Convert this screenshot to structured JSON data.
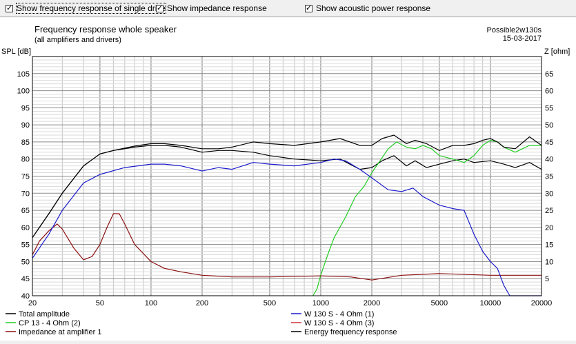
{
  "checkboxes": [
    {
      "label": "Show frequency response of single drive",
      "checked": true
    },
    {
      "label": "Show impedance response",
      "checked": true
    },
    {
      "label": "Show acoustic power response",
      "checked": true
    }
  ],
  "chart_data": {
    "type": "line",
    "title": "Frequency response whole speaker",
    "subtitle": "(all amplifiers and drivers)",
    "top_right": [
      "Possible2w130s",
      "15-03-2017"
    ],
    "ylabel_left": "SPL [dB]",
    "ylabel_right": "Z [ohm]",
    "x_scale": "log",
    "xlim": [
      20,
      20000
    ],
    "ylim_left": [
      40,
      110
    ],
    "ylim_right": [
      0,
      70
    ],
    "x_ticks": [
      20,
      50,
      100,
      200,
      500,
      1000,
      2000,
      5000,
      10000,
      20000
    ],
    "x_tick_labels": [
      "20",
      "50",
      "100",
      "200",
      "500",
      "1000",
      "2000",
      "5000",
      "10000",
      "20000"
    ],
    "y_ticks_left": [
      "40",
      "45",
      "50",
      "55",
      "60",
      "65",
      "70",
      "75",
      "80",
      "85",
      "90",
      "95",
      "100",
      "105"
    ],
    "y_ticks_right": [
      "5",
      "10",
      "15",
      "20",
      "25",
      "30",
      "35",
      "40",
      "45",
      "50",
      "55",
      "60",
      "65"
    ],
    "grid": true,
    "series": [
      {
        "name": "Total amplitude",
        "axis": "left",
        "color": "#000000",
        "x": [
          20,
          25,
          30,
          40,
          50,
          60,
          70,
          80,
          100,
          120,
          150,
          200,
          250,
          300,
          400,
          500,
          700,
          1000,
          1300,
          1700,
          2000,
          2300,
          2700,
          3200,
          3600,
          4200,
          5000,
          6000,
          7000,
          8000,
          10000,
          12000,
          14000,
          17000,
          20000
        ],
        "y": [
          57,
          64,
          70,
          78,
          81.5,
          82.5,
          83,
          83.5,
          84,
          84,
          83.5,
          82,
          82.5,
          82.5,
          82,
          81,
          80,
          79.5,
          80,
          77,
          77.5,
          79.5,
          81,
          78,
          79.5,
          77.5,
          78.5,
          79.5,
          80,
          79,
          79.5,
          78.5,
          77.5,
          79,
          77
        ]
      },
      {
        "name": "CP 13 - 4 Ohm (2)",
        "axis": "left",
        "color": "#22cc22",
        "x": [
          900,
          950,
          1000,
          1100,
          1200,
          1400,
          1600,
          1800,
          2000,
          2200,
          2500,
          2800,
          3200,
          3600,
          4000,
          4500,
          5000,
          6000,
          7000,
          8000,
          9000,
          10000,
          11000,
          12000,
          14000,
          17000,
          20000
        ],
        "y": [
          40,
          42,
          46,
          52,
          57,
          63,
          69,
          72,
          76,
          79,
          83,
          85,
          83.5,
          83,
          84,
          83,
          81,
          80,
          79,
          81,
          84,
          85.5,
          85,
          83.5,
          82,
          84,
          84
        ]
      },
      {
        "name": "Impedance at amplifier 1",
        "axis": "right",
        "color": "#8b1010",
        "x": [
          20,
          22,
          25,
          28,
          30,
          35,
          40,
          45,
          50,
          55,
          60,
          65,
          70,
          80,
          100,
          120,
          150,
          200,
          300,
          500,
          1000,
          1500,
          2000,
          3000,
          5000,
          10000,
          20000
        ],
        "y": [
          12,
          16,
          19,
          21,
          19.5,
          14,
          10.5,
          11.5,
          15,
          20,
          24,
          24,
          21,
          15,
          10,
          8,
          7,
          6,
          5.5,
          5.5,
          5.8,
          5.5,
          4.6,
          6,
          6.5,
          6,
          6
        ]
      },
      {
        "name": "W 130 S - 4 Ohm (1)",
        "axis": "left",
        "color": "#1a1acc",
        "x": [
          20,
          25,
          30,
          40,
          50,
          70,
          100,
          120,
          150,
          200,
          250,
          300,
          400,
          500,
          700,
          1000,
          1200,
          1400,
          1700,
          2000,
          2500,
          3000,
          3500,
          4000,
          5000,
          6000,
          7000,
          8000,
          9000,
          10000,
          11000,
          12000,
          13000,
          20000
        ],
        "y": [
          51,
          58,
          65,
          73,
          75.5,
          77.5,
          78.5,
          78.5,
          78,
          76.5,
          77.5,
          77,
          79,
          78.5,
          78,
          79,
          80,
          79.5,
          77,
          74.5,
          71,
          70.5,
          71.5,
          69,
          66.5,
          65.5,
          65,
          58,
          53,
          50,
          48,
          43,
          40,
          40
        ]
      },
      {
        "name": "W 130 S - 4 Ohm (3)",
        "axis": "left",
        "color": "#cc3333",
        "x": [],
        "y": []
      },
      {
        "name": "Energy frequency response",
        "axis": "left",
        "color": "#000000",
        "x": [
          20,
          25,
          30,
          40,
          50,
          60,
          70,
          80,
          100,
          120,
          150,
          200,
          250,
          300,
          400,
          500,
          700,
          1000,
          1300,
          1700,
          2000,
          2300,
          2700,
          3200,
          3600,
          4200,
          5000,
          6000,
          7000,
          8000,
          9000,
          10000,
          11000,
          12000,
          14000,
          17000,
          20000
        ],
        "y": [
          57,
          64,
          70,
          78,
          81.5,
          82.5,
          83.2,
          83.8,
          84.5,
          84.5,
          84,
          83,
          83,
          83.5,
          85,
          84.5,
          84,
          85,
          86,
          84,
          84,
          86,
          87,
          84.5,
          85.5,
          84.5,
          82.5,
          84,
          84,
          84.5,
          85.5,
          86,
          85,
          83.5,
          83,
          86.5,
          84
        ]
      }
    ],
    "legend": [
      {
        "label": "Total amplitude",
        "color": "#000000"
      },
      {
        "label": "W 130 S - 4 Ohm (1)",
        "color": "#1a1acc"
      },
      {
        "label": "CP 13 - 4 Ohm (2)",
        "color": "#22cc22"
      },
      {
        "label": "W 130 S - 4 Ohm (3)",
        "color": "#cc3333"
      },
      {
        "label": "Impedance at amplifier 1",
        "color": "#8b1010"
      },
      {
        "label": "Energy frequency response",
        "color": "#000000"
      }
    ]
  }
}
